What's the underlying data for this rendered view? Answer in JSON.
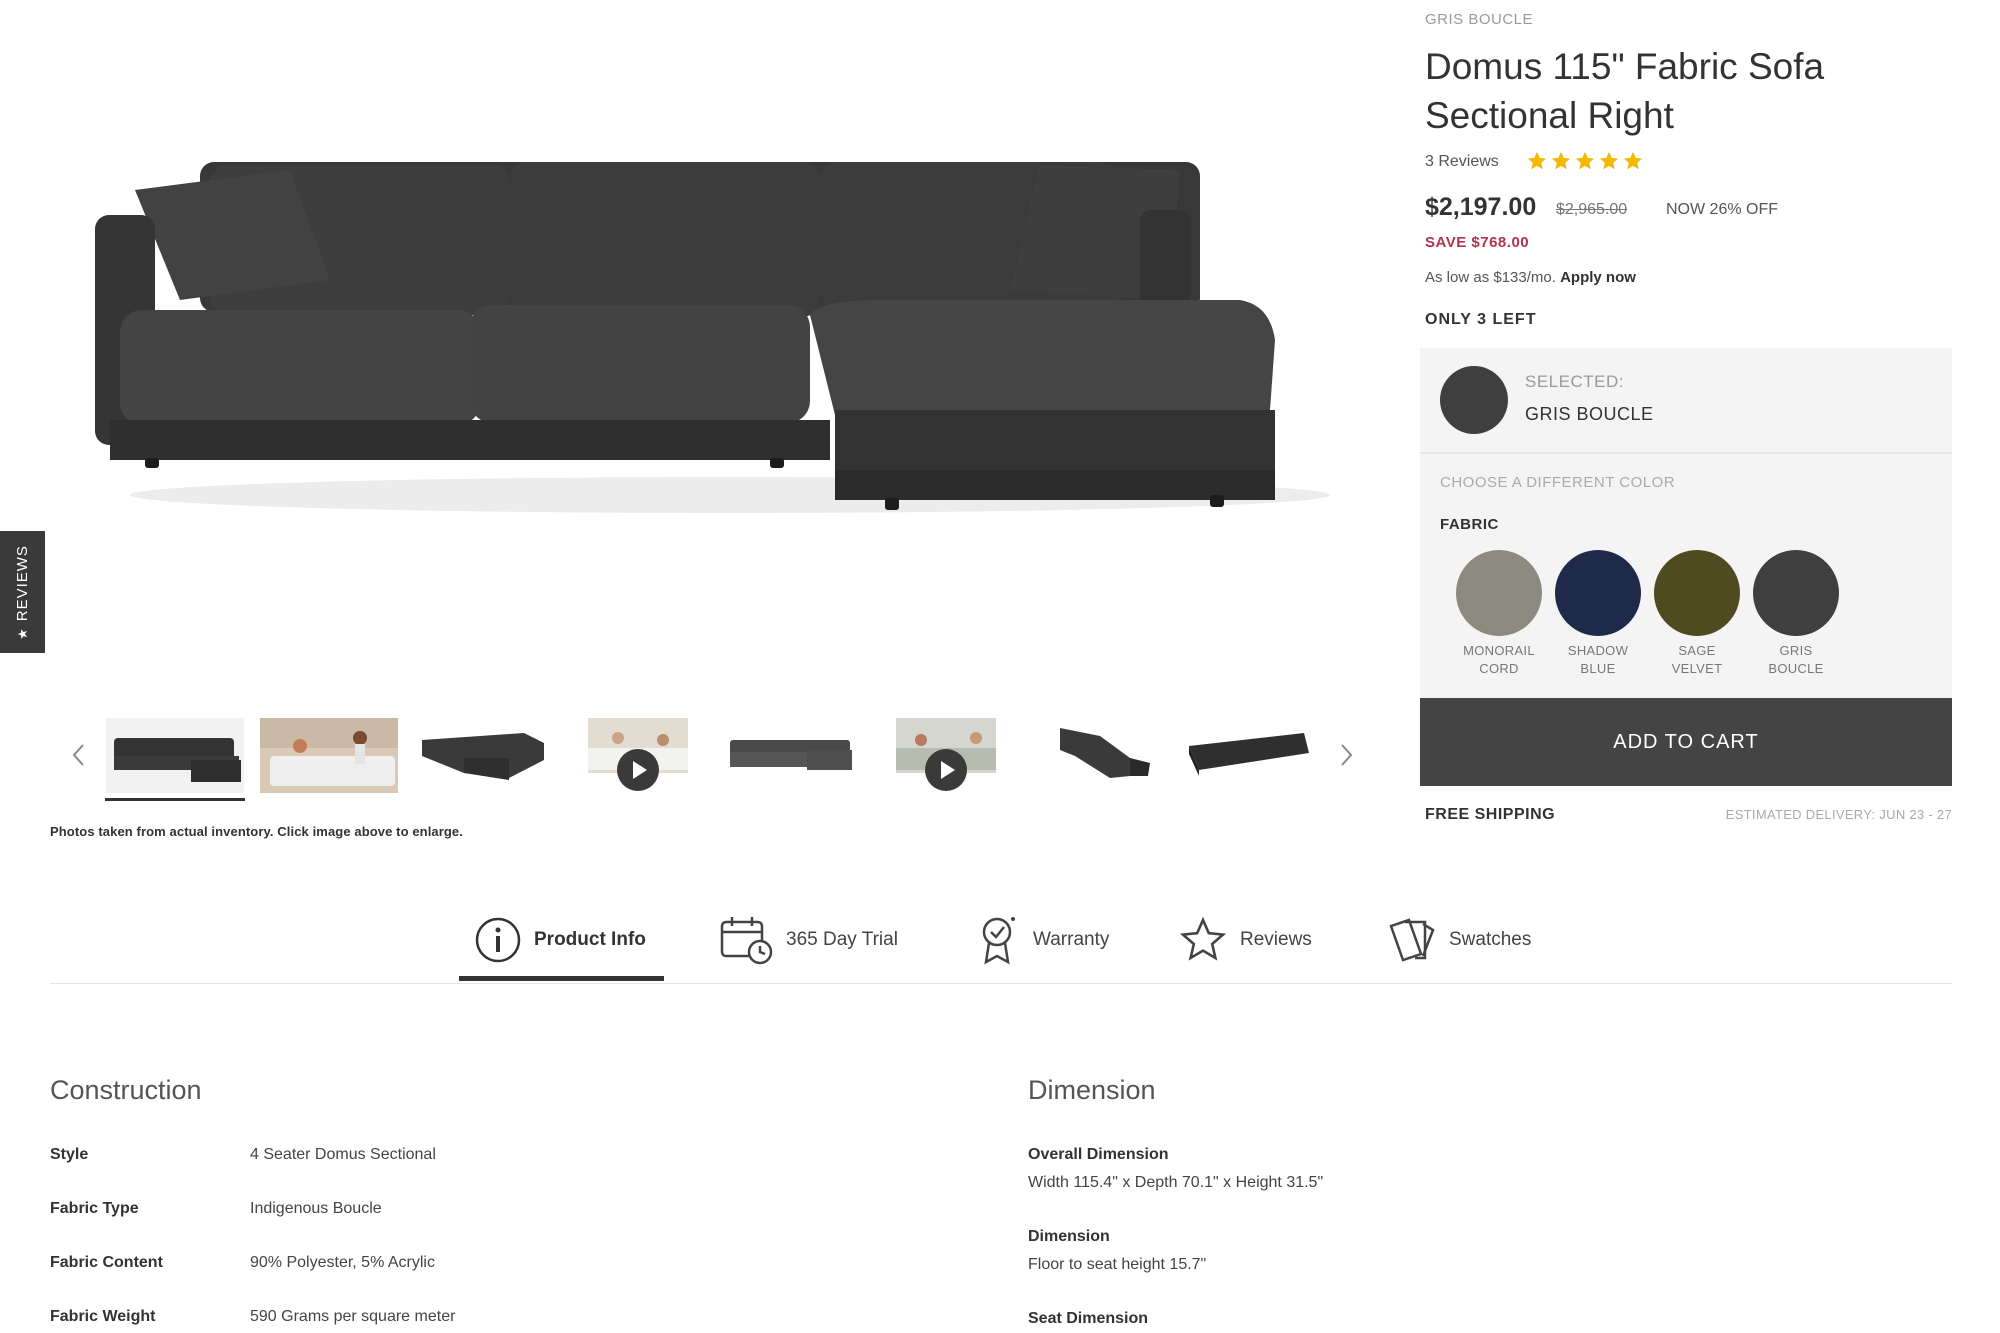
{
  "product": {
    "color_eyebrow": "GRIS BOUCLE",
    "title": "Domus 115\" Fabric Sofa Sectional Right",
    "reviews_label": "3 Reviews",
    "rating": 5,
    "price_now": "$2,197.00",
    "price_was": "$2,965.00",
    "discount": "NOW 26% OFF",
    "savings": "SAVE $768.00",
    "financing_text": "As low as $133/mo.",
    "financing_link": "Apply now",
    "stock": "ONLY 3 LEFT"
  },
  "side_tab": {
    "label": "REVIEWS",
    "icon": "star-icon"
  },
  "gallery": {
    "thumbnail_count": 8,
    "active_index": 0,
    "video_thumbs": [
      3,
      5
    ],
    "note": "Photos taken from actual inventory. Click image above to enlarge.",
    "prev_icon": "chevron-left-icon",
    "next_icon": "chevron-right-icon"
  },
  "colors": {
    "selected_label": "SELECTED:",
    "selected_value": "GRIS BOUCLE",
    "choose_label": "CHOOSE A DIFFERENT COLOR",
    "group_label": "FABRIC",
    "options": [
      {
        "name_line1": "MONORAIL",
        "name_line2": "CORD",
        "color": "#8c897f"
      },
      {
        "name_line1": "SHADOW",
        "name_line2": "BLUE",
        "color": "#1f2a4a"
      },
      {
        "name_line1": "SAGE",
        "name_line2": "VELVET",
        "color": "#4f4a20"
      },
      {
        "name_line1": "GRIS",
        "name_line2": "BOUCLE",
        "color": "#3f3f3f"
      }
    ]
  },
  "cart": {
    "add_label": "ADD TO CART",
    "shipping": "FREE SHIPPING",
    "delivery": "ESTIMATED DELIVERY: JUN 23 - 27"
  },
  "tabs": [
    {
      "label": "Product Info",
      "icon": "info-icon",
      "active": true
    },
    {
      "label": "365 Day Trial",
      "icon": "calendar-clock-icon",
      "active": false
    },
    {
      "label": "Warranty",
      "icon": "ribbon-badge-icon",
      "active": false
    },
    {
      "label": "Reviews",
      "icon": "star-outline-icon",
      "active": false
    },
    {
      "label": "Swatches",
      "icon": "swatch-cards-icon",
      "active": false
    }
  ],
  "construction": {
    "title": "Construction",
    "rows": [
      {
        "key": "Style",
        "value": "4 Seater Domus Sectional"
      },
      {
        "key": "Fabric Type",
        "value": "Indigenous Boucle"
      },
      {
        "key": "Fabric Content",
        "value": "90% Polyester, 5% Acrylic"
      },
      {
        "key": "Fabric Weight",
        "value": "590 Grams per square meter"
      }
    ]
  },
  "dimension": {
    "title": "Dimension",
    "rows": [
      {
        "key": "Overall Dimension",
        "value": "Width 115.4\" x Depth 70.1\" x Height 31.5\""
      },
      {
        "key": "Dimension",
        "value": "Floor to seat height 15.7\""
      },
      {
        "key": "Seat Dimension",
        "value": ""
      }
    ]
  },
  "theme": {
    "accent_dark": "#444444",
    "sale_red": "#b2334b",
    "star_gold": "#f5b800"
  }
}
